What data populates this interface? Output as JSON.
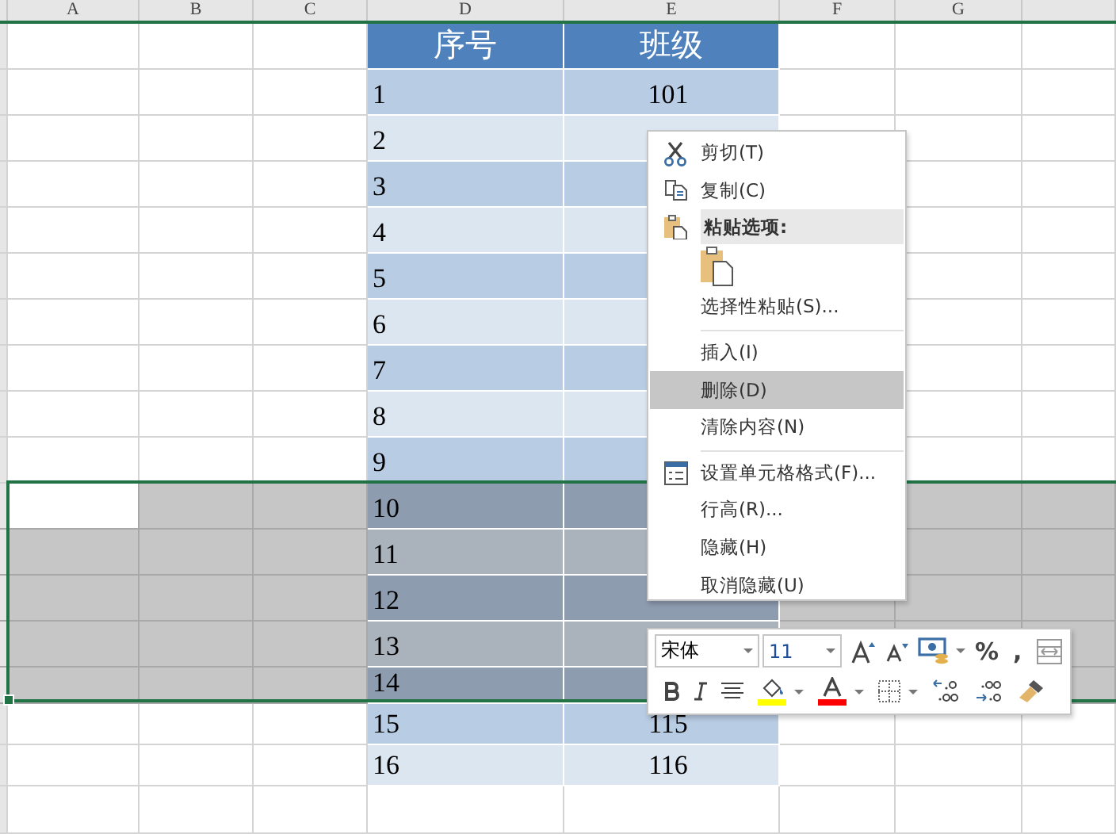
{
  "column_headers": [
    "A",
    "B",
    "C",
    "D",
    "E",
    "F",
    "G"
  ],
  "table": {
    "columns": [
      "序号",
      "班级"
    ],
    "rows": [
      {
        "no": "1",
        "class": "101",
        "selected": false,
        "active": false
      },
      {
        "no": "2",
        "selected": false,
        "active": false
      },
      {
        "no": "3",
        "selected": false,
        "active": false
      },
      {
        "no": "4",
        "selected": false,
        "active": false
      },
      {
        "no": "5",
        "selected": false,
        "active": false
      },
      {
        "no": "6",
        "selected": false,
        "active": false
      },
      {
        "no": "7",
        "selected": false,
        "active": false
      },
      {
        "no": "8",
        "selected": false,
        "active": false
      },
      {
        "no": "9",
        "selected": false,
        "active": false
      },
      {
        "no": "10",
        "selected": true,
        "active": true
      },
      {
        "no": "11",
        "selected": true,
        "active": false
      },
      {
        "no": "12",
        "selected": true,
        "active": false
      },
      {
        "no": "13",
        "selected": true,
        "active": false
      },
      {
        "no": "14",
        "selected": true,
        "active": false
      },
      {
        "no": "15",
        "class": "115",
        "selected": false,
        "active": false
      },
      {
        "no": "16",
        "class": "116",
        "selected": false,
        "active": false
      }
    ]
  },
  "context_menu": [
    {
      "kind": "item",
      "label": "剪切(T)",
      "selected": false
    },
    {
      "kind": "item",
      "label": "复制(C)",
      "selected": false
    },
    {
      "kind": "header",
      "label": "粘贴选项:"
    },
    {
      "kind": "paste-options"
    },
    {
      "kind": "item",
      "label": "选择性粘贴(S)...",
      "selected": false
    },
    {
      "kind": "separator"
    },
    {
      "kind": "item",
      "label": "插入(I)",
      "selected": false
    },
    {
      "kind": "item",
      "label": "删除(D)",
      "selected": true
    },
    {
      "kind": "item",
      "label": "清除内容(N)",
      "selected": false
    },
    {
      "kind": "separator"
    },
    {
      "kind": "item",
      "label": "设置单元格格式(F)...",
      "selected": false
    },
    {
      "kind": "item",
      "label": "行高(R)...",
      "selected": false
    },
    {
      "kind": "item",
      "label": "隐藏(H)",
      "selected": false
    },
    {
      "kind": "item",
      "label": "取消隐藏(U)",
      "selected": false
    }
  ],
  "mini_toolbar": {
    "font": "宋体",
    "size": "11",
    "comma": ",",
    "percent": "%"
  }
}
